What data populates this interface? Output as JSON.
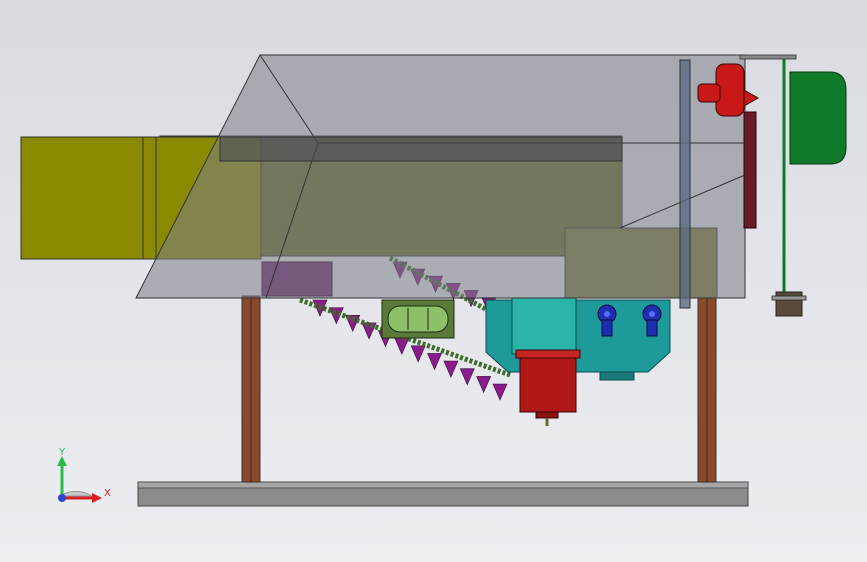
{
  "viewport": {
    "background_top": "#d9dbe1",
    "background_bottom": "#eceef2"
  },
  "triad": {
    "y_label": "Y",
    "x_label": "X",
    "y_color": "#2db84a",
    "x_color": "#d82020",
    "z_color": "#2a46d8"
  },
  "colors": {
    "feed_chute": "#8a8a00",
    "hopper_glass": "#7d8088",
    "tray": "#6b6a2a",
    "frame_legs": "#8a4a2a",
    "base_rail": "#8c8c8c",
    "gearbox": "#1f9a9a",
    "motor": "#b01818",
    "spike_chain": "#8a1c8a",
    "chain": "#3d6b2a",
    "green_panel": "#0f7a2a",
    "red_pump": "#c81818"
  },
  "icons": {
    "triad": "coordinate-triad-icon"
  }
}
